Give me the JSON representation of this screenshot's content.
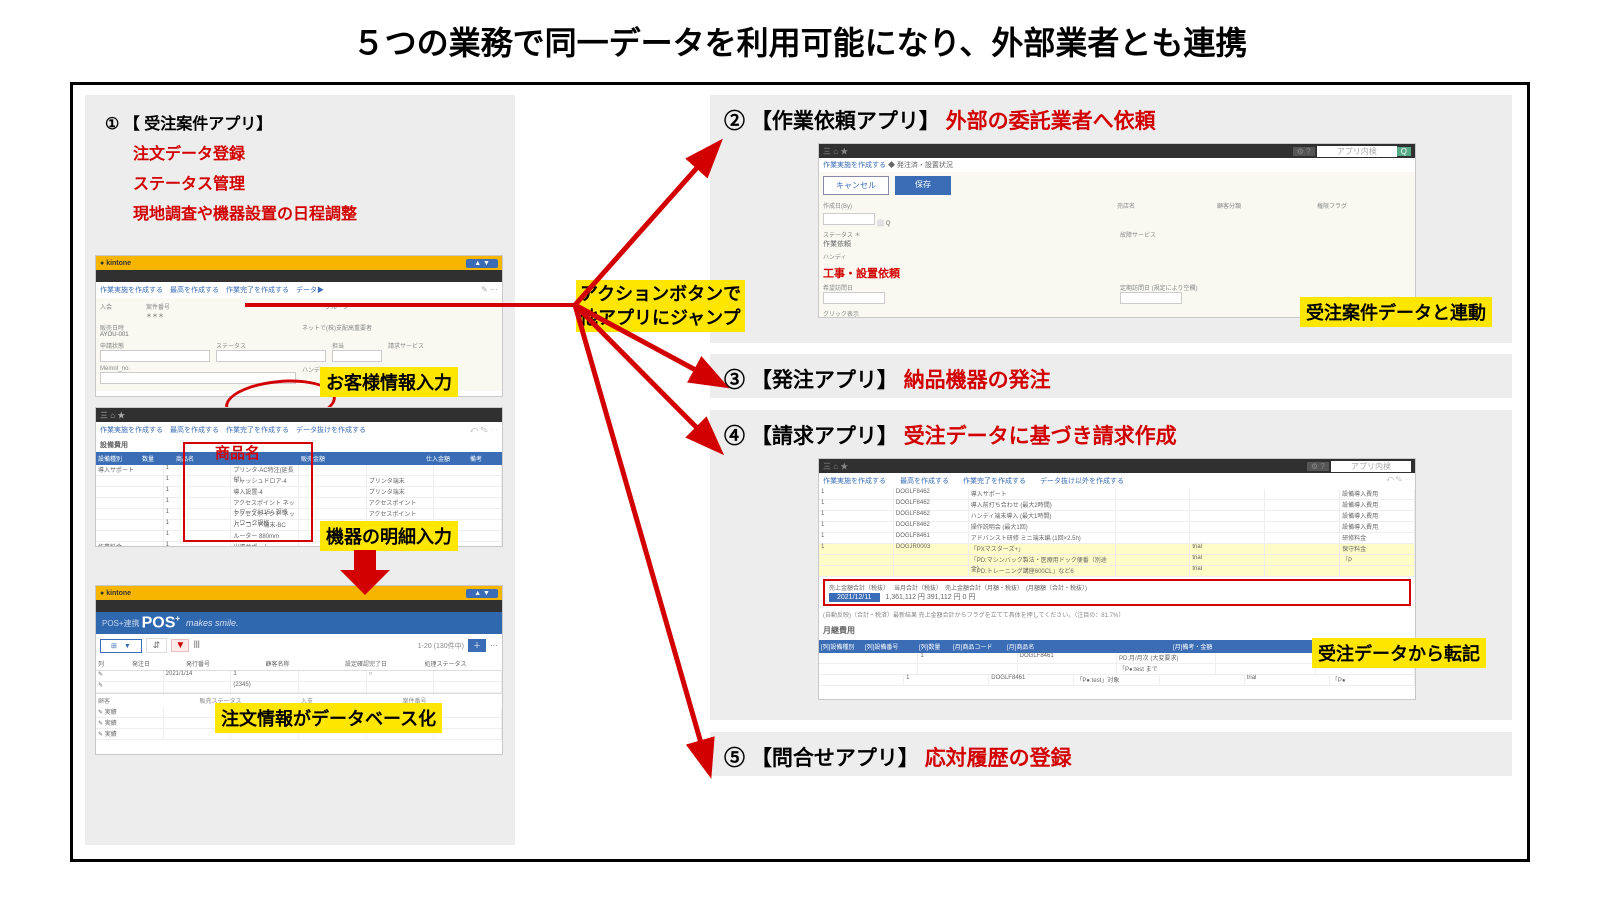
{
  "title": "５つの業務で同一データを利用可能になり、外部業者とも連携",
  "action_label_line1": "アクションボタンで",
  "action_label_line2": "他アプリにジャンプ",
  "left": {
    "heading_num": "①",
    "heading_bracket": "【 受注案件アプリ】",
    "line1": "注文データ登録",
    "line2": "ステータス管理",
    "line3": "現地調査や機器設置の日程調整",
    "kintone": "kintone",
    "pos_label": "POS+連携",
    "pos_slogan": "makes smile.",
    "callout_customer": "お客様情報入力",
    "callout_item": "機器の明細入力",
    "callout_db": "注文情報がデータベース化",
    "product_header": "商品名"
  },
  "right": {
    "p2": {
      "num": "②",
      "title_black": "【作業依頼アプリ】",
      "title_red": "外部の委託業者へ依頼",
      "callout": "受注案件データと連動",
      "link_txt": "作業実施を作成する",
      "cancel": "キャンセル",
      "save": "保存",
      "section_red": "工事・設置依頼"
    },
    "p3": {
      "num": "③",
      "title_black": "【発注アプリ】",
      "title_red": "納品機器の発注"
    },
    "p4": {
      "num": "④",
      "title_black": "【請求アプリ】",
      "title_red": "受注データに基づき請求作成",
      "callout": "受注データから転記",
      "links": "作業実施を作成する　　最高を作成する　　作業完了を作成する　　データ抜け以外を作成する",
      "rows": [
        [
          "1",
          "DOGLF8462",
          "導入サポート",
          "",
          "",
          "",
          "設備導入費用"
        ],
        [
          "1",
          "DOGLF8462",
          "導入前打ち合わせ (最大2時間)",
          "",
          "",
          "",
          "設備導入費用"
        ],
        [
          "1",
          "DOGLF8462",
          "ハンディ端末導入 (最大1時間)",
          "",
          "",
          "",
          "設備導入費用"
        ],
        [
          "1",
          "DOGLF8462",
          "操作説明会 (最大1回)",
          "",
          "",
          "",
          "設備導入費用"
        ],
        [
          "1",
          "DOGLF8461",
          "アドバンスト研修 ミニ端末編 (1回×2.5h)",
          "",
          "",
          "",
          "研修料金"
        ],
        [
          "1",
          "DOGJR0003",
          "「PXマスターズ+」",
          "",
          "trial",
          "",
          "保守料金"
        ],
        [
          "",
          "",
          "「PD:マシンバック製法・医療用ドック便番（別途金）",
          "",
          "trial",
          "",
          "「P"
        ],
        [
          "",
          "",
          "「PD:トレーニング講座600CL」など6",
          "",
          "trial",
          "",
          ""
        ]
      ],
      "total_label": "売上金額合計（税抜）",
      "total_extra": "当月合計（税抜）　売上金額合計（月額・税抜）　(月額額（合計・税抜）)",
      "total_value": "2021/12/11",
      "total_numbers": "1,361,112 円        391,112 円        0 円",
      "note": "(自動反映)（合計・税済）最新結果 売上金額合計からフラグを立てて具体を押してください。（注目の：81.7%）",
      "sub_header": "月継費用"
    },
    "p5": {
      "num": "⑤",
      "title_black": "【問合せアプリ】",
      "title_red": "応対履歴の登録"
    }
  }
}
